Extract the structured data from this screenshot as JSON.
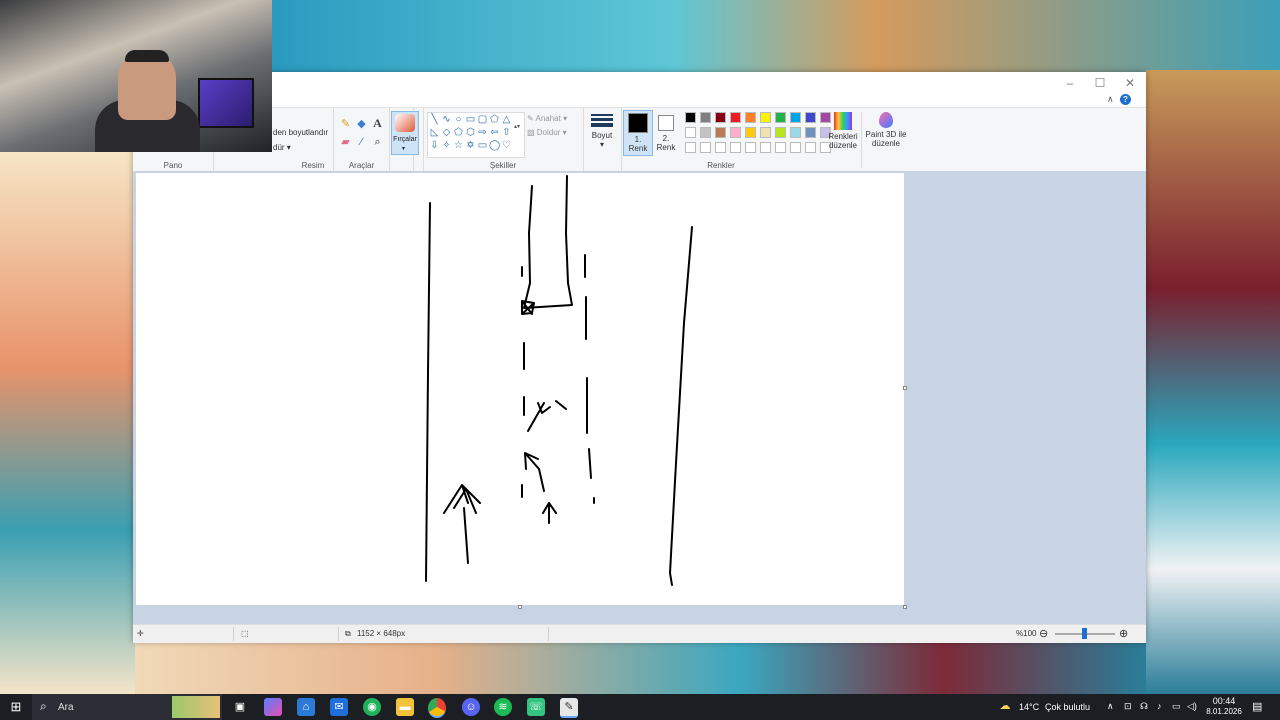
{
  "ribbon": {
    "clipboard_label": "Pano",
    "image_label": "Resim",
    "image_resize": "den boyutlandır",
    "image_rotate": "dür",
    "tools_label": "Araçlar",
    "brushes_label": "Fırçalar",
    "shapes_label": "Şekiller",
    "outline_label": "Anahat",
    "fill_label": "Doldur",
    "size_label": "Boyut",
    "color1_label_a": "1.",
    "color1_label_b": "Renk",
    "color2_label_a": "2.",
    "color2_label_b": "Renk",
    "colors_label": "Renkler",
    "edit_colors_a": "Renkleri",
    "edit_colors_b": "düzenle",
    "paint3d_a": "Paint 3D ile",
    "paint3d_b": "düzenle"
  },
  "colors": {
    "color1": "#000000",
    "color2": "#ffffff",
    "palette_row1": [
      "#000000",
      "#7f7f7f",
      "#880015",
      "#ed1c24",
      "#ff7f27",
      "#fff200",
      "#22b14c",
      "#00a2e8",
      "#3f48cc",
      "#a349a4"
    ],
    "palette_row2": [
      "#ffffff",
      "#c3c3c3",
      "#b97a57",
      "#ffaec9",
      "#ffc90e",
      "#efe4b0",
      "#b5e61d",
      "#99d9ea",
      "#7092be",
      "#c8bfe7"
    ],
    "palette_row3": [
      "#ffffff",
      "#ffffff",
      "#ffffff",
      "#ffffff",
      "#ffffff",
      "#ffffff",
      "#ffffff",
      "#ffffff",
      "#ffffff",
      "#ffffff"
    ]
  },
  "status": {
    "dimensions": "1152 × 648px",
    "zoom": "%100",
    "zoom_level": 1.0
  },
  "taskbar": {
    "search_placeholder": "Ara",
    "weather_temp": "14°C",
    "weather_text": "Çok bulutlu",
    "time": "00:44",
    "date": "8.01.2026"
  }
}
